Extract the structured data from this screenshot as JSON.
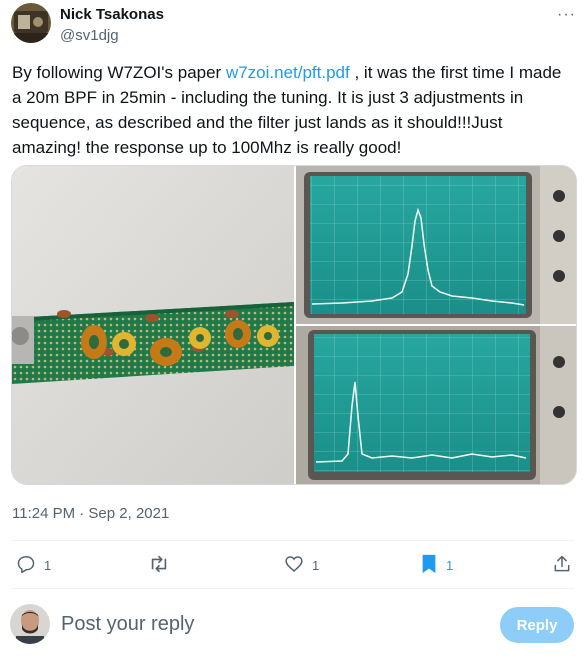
{
  "author": {
    "name": "Nick Tsakonas",
    "handle": "@sv1djg"
  },
  "more_glyph": "···",
  "tweet": {
    "part1": "By following W7ZOI's paper ",
    "link": "w7zoi.net/pft.pdf",
    "part2": " , it was the first time I made a 20m BPF in 25min - including the tuning. It is just 3 adjustments in sequence, as described and the filter just lands as it should!!!Just amazing! the response up to 100Mhz is really good!"
  },
  "timestamp": "11:24 PM · Sep 2, 2021",
  "actions": {
    "reply_count": "1",
    "retweet_count": "",
    "like_count": "1",
    "bookmark_count": "1"
  },
  "reply_box": {
    "placeholder": "Post your reply",
    "button": "Reply"
  },
  "colors": {
    "accent": "#1d9bf0",
    "muted": "#536471",
    "reply_button": "#8ecdf8"
  }
}
